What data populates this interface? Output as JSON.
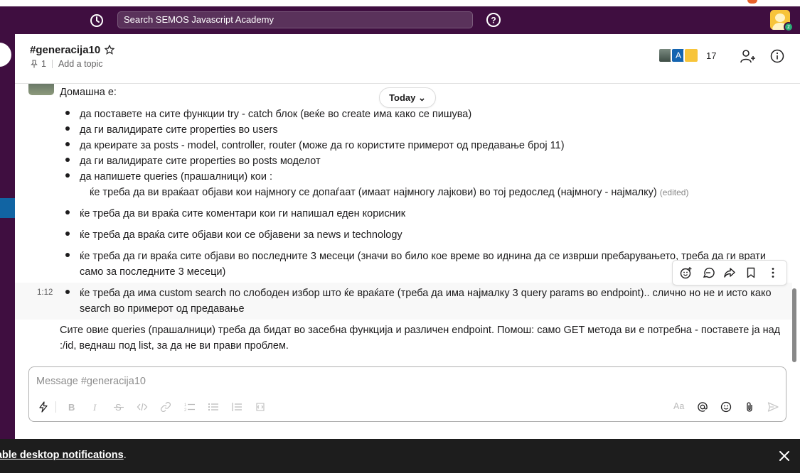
{
  "search": {
    "placeholder": "Search SEMOS Javascript Academy"
  },
  "channel": {
    "name": "#generacija10",
    "pinned_count": "1",
    "add_topic": "Add a topic",
    "member_count": "17",
    "member_avatar_letter": "A"
  },
  "messages": {
    "date_divider": "Today",
    "intro": "Домашна е:",
    "bullets": [
      "да поставете на сите функции try - catch блок (веќе во create има како се пишува)",
      "да ги валидирате сите properties во users",
      "да креирате за posts - model, controller, router (може да го користите примерот од предавање број 11)",
      "да ги валидирате сите properties во posts моделот",
      "да напишете queries (прашалници) кои :"
    ],
    "sub_item": "ќе треба да ви враќаат објави кои најмногу се допаѓаат (имаат најмногу лајкови) во тој редослед (најмногу - најмалку)",
    "edited_label": "(edited)",
    "bullets2": [
      "ќе треба да ви враќа сите коментари кои ги напишал еден корисник",
      "ќе треба да враќа сите објави кои се објавени за news и technology",
      "ќе треба да ги враќа сите објави во последните 3 месеци (значи во било кое време во иднина да се изврши пребарувањето, треба да ги врати само за последните 3 месеци)"
    ],
    "hovered_time": "1:12",
    "hovered_bullet": "ќе треба да има custom search по слободен избор што ќе враќате (треба да има најмалку 3 query params во endpoint).. слично но не и исто како search во примерот од предавање",
    "closing": "Сите овие queries (прашалници) треба да бидат во засебна функција и различен endpoint. Помош: само GET метода ви е потребна - поставете ја над :/id, веднаш под list, за да не ви прави проблем."
  },
  "composer": {
    "placeholder": "Message #generacija10",
    "format_label": "Aa"
  },
  "notification": {
    "text": "nable desktop notifications",
    "suffix": "."
  },
  "colors": {
    "aubergine": "#3f0e40",
    "active_blue": "#1164a3",
    "notif_bg": "#1d1d1d"
  }
}
